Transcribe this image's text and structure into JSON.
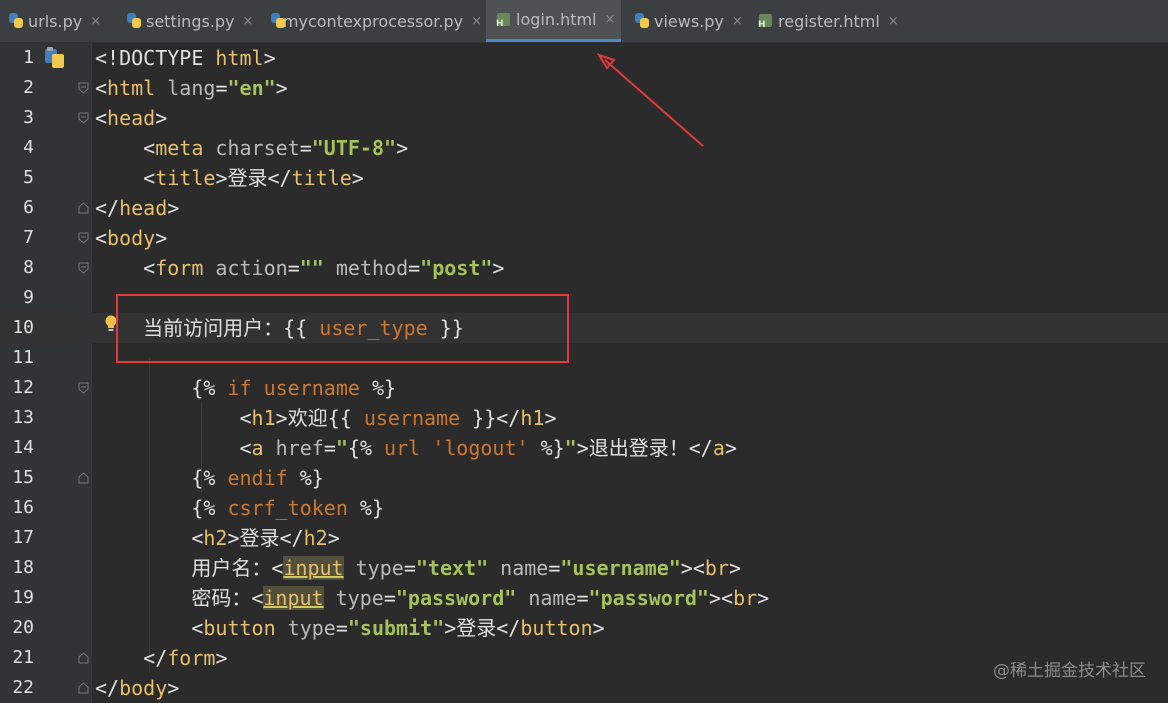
{
  "tabs": [
    {
      "label": "urls.py",
      "icon": "python-file-icon"
    },
    {
      "label": "settings.py",
      "icon": "python-file-icon"
    },
    {
      "label": "mycontexprocessor.py",
      "icon": "python-file-icon"
    },
    {
      "label": "login.html",
      "icon": "html-file-icon",
      "active": true
    },
    {
      "label": "views.py",
      "icon": "python-file-icon"
    },
    {
      "label": "register.html",
      "icon": "html-file-icon"
    }
  ],
  "tab_close_glyph": "×",
  "html_icon_letter": "H",
  "line_numbers": [
    "1",
    "2",
    "3",
    "4",
    "5",
    "6",
    "7",
    "8",
    "9",
    "10",
    "11",
    "12",
    "13",
    "14",
    "15",
    "16",
    "17",
    "18",
    "19",
    "20",
    "21",
    "22"
  ],
  "code": {
    "l1": {
      "a": "<!DOCTYPE ",
      "b": "html",
      "c": ">"
    },
    "l2": {
      "a": "<",
      "b": "html",
      "c": " lang",
      "d": "=",
      "e": "\"en\"",
      "f": ">"
    },
    "l3": {
      "a": "<",
      "b": "head",
      "c": ">"
    },
    "l4": {
      "a": "<",
      "b": "meta",
      "c": " charset",
      "d": "=",
      "e": "\"UTF-8\"",
      "f": ">"
    },
    "l5": {
      "a": "<",
      "b": "title",
      "c": ">",
      "d": "登录",
      "e": "</",
      "f": "title",
      "g": ">"
    },
    "l6": {
      "a": "</",
      "b": "head",
      "c": ">"
    },
    "l7": {
      "a": "<",
      "b": "body",
      "c": ">"
    },
    "l8": {
      "a": "<",
      "b": "form",
      "c": " action",
      "d": "=",
      "e": "\"\"",
      "f": " method",
      "g": "=",
      "h": "\"post\"",
      "i": ">"
    },
    "l10": {
      "a": "当前访问用户：",
      "b": "{{ ",
      "c": "user_type",
      "d": " }}"
    },
    "l12": {
      "a": "{% ",
      "b": "if",
      "c": " username",
      "d": " %}"
    },
    "l13": {
      "a": "<",
      "b": "h1",
      "c": ">",
      "d": "欢迎",
      "e": "{{ ",
      "f": "username",
      "g": " }}",
      "h": "</",
      "i": "h1",
      "j": ">"
    },
    "l14": {
      "a": "<",
      "b": "a",
      "c": " href",
      "d": "=",
      "e": "\"",
      "f": "{% ",
      "g": "url",
      "h": " 'logout'",
      "i": " %}",
      "j": "\"",
      "k": ">",
      "l": "退出登录！",
      "m": "</",
      "n": "a",
      "o": ">"
    },
    "l15": {
      "a": "{% ",
      "b": "endif",
      "c": " %}"
    },
    "l16": {
      "a": "{% ",
      "b": "csrf_token",
      "c": " %}"
    },
    "l17": {
      "a": "<",
      "b": "h2",
      "c": ">",
      "d": "登录",
      "e": "</",
      "f": "h2",
      "g": ">"
    },
    "l18": {
      "a": "用户名：",
      "b": "<",
      "c": "input",
      "d": " type",
      "e": "=",
      "f": "\"text\"",
      "g": " name",
      "h": "=",
      "i": "\"username\"",
      "j": "><",
      "k": "br",
      "l": ">"
    },
    "l19": {
      "a": "密码：",
      "b": "<",
      "c": "input",
      "d": " type",
      "e": "=",
      "f": "\"password\"",
      "g": " name",
      "h": "=",
      "i": "\"password\"",
      "j": "><",
      "k": "br",
      "l": ">"
    },
    "l20": {
      "a": "<",
      "b": "button",
      "c": " type",
      "d": "=",
      "e": "\"submit\"",
      "f": ">",
      "g": "登录",
      "h": "</",
      "i": "button",
      "j": ">"
    },
    "l21": {
      "a": "</",
      "b": "form",
      "c": ">"
    },
    "l22": {
      "a": "</",
      "b": "body",
      "c": ">"
    }
  },
  "watermark": "@稀土掘金技术社区",
  "colors": {
    "annotation": "#e23a3a",
    "accent_tab_underline": "#4a88c7"
  }
}
